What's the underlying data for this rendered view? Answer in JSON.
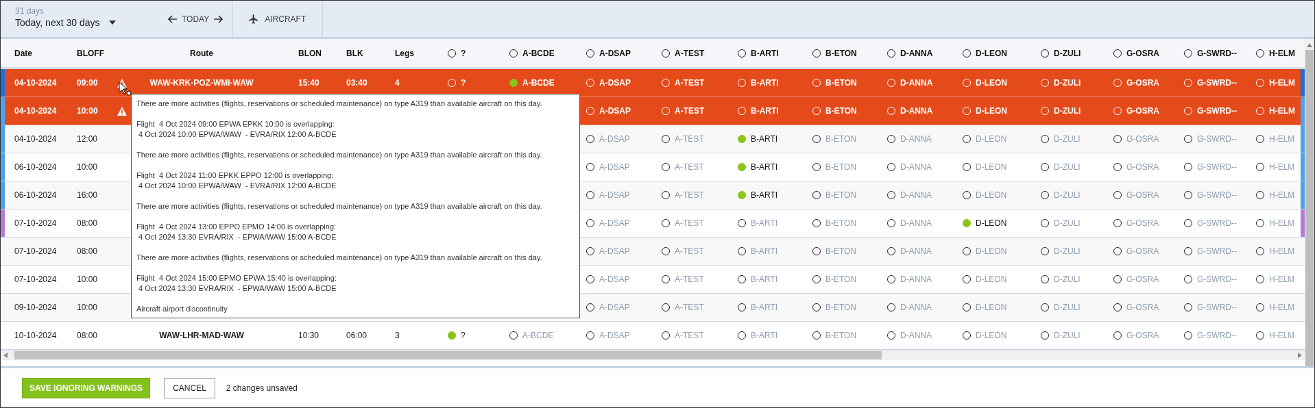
{
  "toolbar": {
    "period_caption": "31 days",
    "period": "Today, next 30 days",
    "today": "TODAY",
    "aircraft": "AIRCRAFT"
  },
  "columns": [
    "Date",
    "BLOFF",
    "Route",
    "BLON",
    "BLK",
    "Legs"
  ],
  "aircraft_columns": [
    "?",
    "A-BCDE",
    "A-DSAP",
    "A-TEST",
    "B-ARTI",
    "B-ETON",
    "D-ANNA",
    "D-LEON",
    "D-ZULI",
    "G-OSRA",
    "G-SWRD--",
    "H-ELM"
  ],
  "rows": [
    {
      "date": "04-10-2024",
      "bloff": "09:00",
      "warning": true,
      "flagged": true,
      "color": "#1e6fd9",
      "route": "WAW-KRK-POZ-WMI-WAW",
      "blon": "15:40",
      "blk": "03:40",
      "legs": "4",
      "aircraft": [
        {
          "label": "?",
          "selected": false
        },
        {
          "label": "A-BCDE",
          "selected": true
        },
        {
          "label": "A-DSAP",
          "selected": false
        },
        {
          "label": "A-TEST",
          "selected": false
        },
        {
          "label": "B-ARTI",
          "selected": false
        },
        {
          "label": "B-ETON",
          "selected": false
        },
        {
          "label": "D-ANNA",
          "selected": false
        },
        {
          "label": "D-LEON",
          "selected": false
        },
        {
          "label": "D-ZULI",
          "selected": false
        },
        {
          "label": "G-OSRA",
          "selected": false
        },
        {
          "label": "G-SWRD--",
          "selected": false
        },
        {
          "label": "H-ELM",
          "selected": false
        }
      ]
    },
    {
      "date": "04-10-2024",
      "bloff": "10:00",
      "warning": true,
      "flagged": true,
      "color": "#4ba3ee",
      "aircraft": [
        {
          "label": "A-DSAP",
          "selected": false
        },
        {
          "label": "A-TEST",
          "selected": false
        },
        {
          "label": "B-ARTI",
          "selected": false
        },
        {
          "label": "B-ETON",
          "selected": false
        },
        {
          "label": "D-ANNA",
          "selected": false
        },
        {
          "label": "D-LEON",
          "selected": false
        },
        {
          "label": "D-ZULI",
          "selected": false
        },
        {
          "label": "G-OSRA",
          "selected": false
        },
        {
          "label": "G-SWRD--",
          "selected": false
        },
        {
          "label": "H-ELM",
          "selected": false
        }
      ]
    },
    {
      "date": "04-10-2024",
      "bloff": "12:00",
      "warning": false,
      "flagged": false,
      "color": "#4ba3ee",
      "aircraft": [
        {
          "label": "A-DSAP",
          "selected": false
        },
        {
          "label": "A-TEST",
          "selected": false
        },
        {
          "label": "B-ARTI",
          "selected": true
        },
        {
          "label": "B-ETON",
          "selected": false
        },
        {
          "label": "D-ANNA",
          "selected": false
        },
        {
          "label": "D-LEON",
          "selected": false
        },
        {
          "label": "D-ZULI",
          "selected": false
        },
        {
          "label": "G-OSRA",
          "selected": false
        },
        {
          "label": "G-SWRD--",
          "selected": false
        },
        {
          "label": "H-ELM",
          "selected": false
        }
      ]
    },
    {
      "date": "06-10-2024",
      "bloff": "10:00",
      "warning": false,
      "flagged": false,
      "color": "#4ba3ee",
      "aircraft": [
        {
          "label": "A-DSAP",
          "selected": false
        },
        {
          "label": "A-TEST",
          "selected": false
        },
        {
          "label": "B-ARTI",
          "selected": true
        },
        {
          "label": "B-ETON",
          "selected": false
        },
        {
          "label": "D-ANNA",
          "selected": false
        },
        {
          "label": "D-LEON",
          "selected": false
        },
        {
          "label": "D-ZULI",
          "selected": false
        },
        {
          "label": "G-OSRA",
          "selected": false
        },
        {
          "label": "G-SWRD--",
          "selected": false
        },
        {
          "label": "H-ELM",
          "selected": false
        }
      ]
    },
    {
      "date": "06-10-2024",
      "bloff": "16:00",
      "warning": false,
      "flagged": false,
      "color": "#4ba3ee",
      "aircraft": [
        {
          "label": "A-DSAP",
          "selected": false
        },
        {
          "label": "A-TEST",
          "selected": false
        },
        {
          "label": "B-ARTI",
          "selected": true
        },
        {
          "label": "B-ETON",
          "selected": false
        },
        {
          "label": "D-ANNA",
          "selected": false
        },
        {
          "label": "D-LEON",
          "selected": false
        },
        {
          "label": "D-ZULI",
          "selected": false
        },
        {
          "label": "G-OSRA",
          "selected": false
        },
        {
          "label": "G-SWRD--",
          "selected": false
        },
        {
          "label": "H-ELM",
          "selected": false
        }
      ]
    },
    {
      "date": "07-10-2024",
      "bloff": "08:00",
      "warning": false,
      "flagged": false,
      "color": "#b57bdc",
      "aircraft": [
        {
          "label": "A-DSAP",
          "selected": false
        },
        {
          "label": "A-TEST",
          "selected": false
        },
        {
          "label": "B-ARTI",
          "selected": false
        },
        {
          "label": "B-ETON",
          "selected": false
        },
        {
          "label": "D-ANNA",
          "selected": false
        },
        {
          "label": "D-LEON",
          "selected": true
        },
        {
          "label": "D-ZULI",
          "selected": false
        },
        {
          "label": "G-OSRA",
          "selected": false
        },
        {
          "label": "G-SWRD--",
          "selected": false
        },
        {
          "label": "H-ELM",
          "selected": false
        }
      ]
    },
    {
      "date": "07-10-2024",
      "bloff": "08:00",
      "warning": false,
      "flagged": false,
      "aircraft": [
        {
          "label": "A-DSAP",
          "selected": false
        },
        {
          "label": "A-TEST",
          "selected": false
        },
        {
          "label": "B-ARTI",
          "selected": false
        },
        {
          "label": "B-ETON",
          "selected": false
        },
        {
          "label": "D-ANNA",
          "selected": false
        },
        {
          "label": "D-LEON",
          "selected": false
        },
        {
          "label": "D-ZULI",
          "selected": false
        },
        {
          "label": "G-OSRA",
          "selected": false
        },
        {
          "label": "G-SWRD--",
          "selected": false
        },
        {
          "label": "H-ELM",
          "selected": false
        }
      ]
    },
    {
      "date": "07-10-2024",
      "bloff": "10:00",
      "warning": false,
      "flagged": false,
      "aircraft": [
        {
          "label": "A-DSAP",
          "selected": false
        },
        {
          "label": "A-TEST",
          "selected": false
        },
        {
          "label": "B-ARTI",
          "selected": false
        },
        {
          "label": "B-ETON",
          "selected": false
        },
        {
          "label": "D-ANNA",
          "selected": false
        },
        {
          "label": "D-LEON",
          "selected": false
        },
        {
          "label": "D-ZULI",
          "selected": false
        },
        {
          "label": "G-OSRA",
          "selected": false
        },
        {
          "label": "G-SWRD--",
          "selected": false
        },
        {
          "label": "H-ELM",
          "selected": false
        }
      ]
    },
    {
      "date": "09-10-2024",
      "bloff": "10:00",
      "warning": false,
      "flagged": false,
      "aircraft": [
        {
          "label": "A-DSAP",
          "selected": false
        },
        {
          "label": "A-TEST",
          "selected": false
        },
        {
          "label": "B-ARTI",
          "selected": false
        },
        {
          "label": "B-ETON",
          "selected": false
        },
        {
          "label": "D-ANNA",
          "selected": false
        },
        {
          "label": "D-LEON",
          "selected": false
        },
        {
          "label": "D-ZULI",
          "selected": false
        },
        {
          "label": "G-OSRA",
          "selected": false
        },
        {
          "label": "G-SWRD--",
          "selected": false
        },
        {
          "label": "H-ELM",
          "selected": false
        }
      ]
    },
    {
      "date": "10-10-2024",
      "bloff": "08:00",
      "warning": false,
      "flagged": false,
      "route": "WAW-LHR-MAD-WAW",
      "blon": "10:30",
      "blk": "06:00",
      "legs": "3",
      "aircraft": [
        {
          "label": "?",
          "selected": true
        },
        {
          "label": "A-BCDE",
          "selected": false
        },
        {
          "label": "A-DSAP",
          "selected": false
        },
        {
          "label": "A-TEST",
          "selected": false
        },
        {
          "label": "B-ARTI",
          "selected": false
        },
        {
          "label": "B-ETON",
          "selected": false
        },
        {
          "label": "D-ANNA",
          "selected": false
        },
        {
          "label": "D-LEON",
          "selected": false
        },
        {
          "label": "D-ZULI",
          "selected": false
        },
        {
          "label": "G-OSRA",
          "selected": false
        },
        {
          "label": "G-SWRD--",
          "selected": false
        },
        {
          "label": "H-ELM",
          "selected": false
        }
      ]
    }
  ],
  "tooltip": {
    "messages": [
      "There are more activities (flights, reservations or scheduled maintenance) on type A319 than available aircraft on this day.",
      "Flight  4 Oct 2024 09:00 EPWA EPKK 10:00 is overlapping:\n 4 Oct 2024 10:00 EPWA/WAW  - EVRA/RIX 12:00 A-BCDE",
      "There are more activities (flights, reservations or scheduled maintenance) on type A319 than available aircraft on this day.",
      "Flight  4 Oct 2024 11:00 EPKK EPPO 12:00 is overlapping:\n 4 Oct 2024 10:00 EPWA/WAW  - EVRA/RIX 12:00 A-BCDE",
      "There are more activities (flights, reservations or scheduled maintenance) on type A319 than available aircraft on this day.",
      "Flight  4 Oct 2024 13:00 EPPO EPMO 14:00 is overlapping:\n 4 Oct 2024 13:30 EVRA/RIX  - EPWA/WAW 15:00 A-BCDE",
      "There are more activities (flights, reservations or scheduled maintenance) on type A319 than available aircraft on this day.",
      "Flight  4 Oct 2024 15:00 EPMO EPWA 15:40 is overlapping:\n 4 Oct 2024 13:30 EVRA/RIX  - EPWA/WAW 15:00 A-BCDE",
      "Aircraft airport discontinuity"
    ]
  },
  "footer": {
    "save": "SAVE IGNORING WARNINGS",
    "cancel": "CANCEL",
    "status": "2 changes unsaved"
  }
}
